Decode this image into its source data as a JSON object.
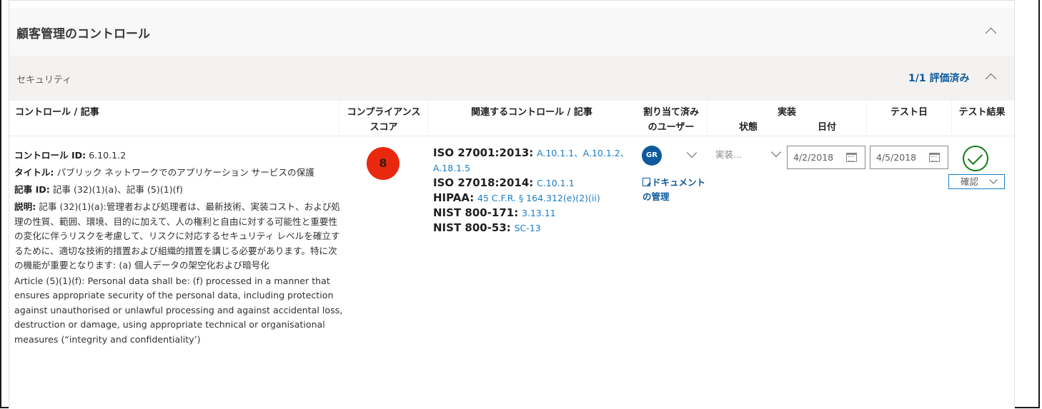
{
  "section": {
    "title": "顧客管理のコントロール"
  },
  "group": {
    "title": "セキュリティ",
    "status": "1/1 評価済み"
  },
  "columns": {
    "control": "コントロール / 記事",
    "score_line1": "コンプライアンス",
    "score_line2": "スコア",
    "related": "関連するコントロール / 記事",
    "assigned_line1": "割り当て済み",
    "assigned_line2": "のユーザー",
    "implementation": "実装",
    "impl_status": "状態",
    "impl_date": "日付",
    "test_date": "テスト日",
    "test_result": "テスト結果"
  },
  "row": {
    "control_id_label": "コントロール ID:",
    "control_id": "6.10.1.2",
    "title_label": "タイトル:",
    "title": "パブリック ネットワークでのアプリケーション サービスの保護",
    "article_id_label": "記事 ID:",
    "article_id": "記事 (32)(1)(a)、記事 (5)(1)(f)",
    "description_label": "説明:",
    "description": "記事 (32)(1)(a):管理者および処理者は、最新技術、実装コスト、および処理の性質、範囲、環境、目的に加えて、人の権利と自由に対する可能性と重要性の変化に伴うリスクを考慮して、リスクに対応するセキュリティ レベルを確立するために、適切な技術的措置および組織的措置を講じる必要があります。特に次の機能が重要となります: (a) 個人データの架空化および暗号化",
    "article_text": "Article (5)(1)(f): Personal data shall be: (f) processed in a manner that ensures appropriate security of the personal data, including protection against unauthorised or unlawful processing and against accidental loss, destruction or damage, using appropriate technical or organisational measures (“integrity and confidentiality’)",
    "score": "8",
    "score_color": "#e8290e",
    "related": [
      {
        "standard": "ISO 27001:2013:",
        "refs": "A.10.1.1、A.10.1.2、A.18.1.5"
      },
      {
        "standard": "ISO 27018:2014:",
        "refs": "C.10.1.1"
      },
      {
        "standard": "HIPAA:",
        "refs": "45 C.F.R. § 164.312(e)(2)(ii)"
      },
      {
        "standard": "NIST 800-171:",
        "refs": "3.13.11"
      },
      {
        "standard": "NIST 800-53:",
        "refs": "SC-13"
      }
    ],
    "assigned_user": "GR",
    "document_link": "ドキュメントの管理",
    "impl_status_placeholder": "実装...",
    "impl_date": "4/2/2018",
    "test_date": "4/5/2018",
    "test_result_icon": "check-circle-icon",
    "confirm_label": "確認"
  },
  "colors": {
    "accent": "#0f5a9c",
    "link": "#1a7dc8",
    "success": "#107c10"
  }
}
